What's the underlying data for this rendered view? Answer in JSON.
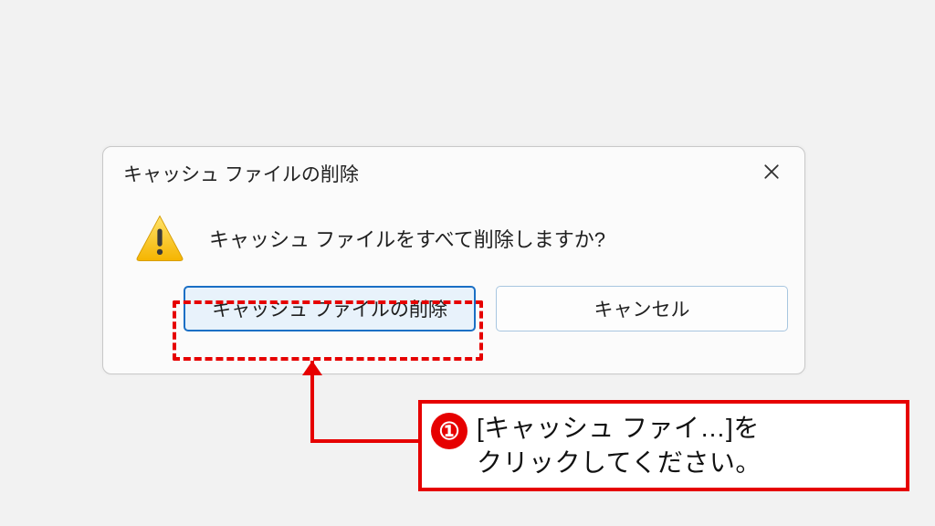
{
  "dialog": {
    "title": "キャッシュ ファイルの削除",
    "message": "キャッシュ ファイルをすべて削除しますか?",
    "primary_label": "キャッシュ ファイルの削除",
    "secondary_label": "キャンセル"
  },
  "annotation": {
    "step_number": "①",
    "instruction": "[キャッシュ ファイ…]を\nクリックしてください。"
  }
}
